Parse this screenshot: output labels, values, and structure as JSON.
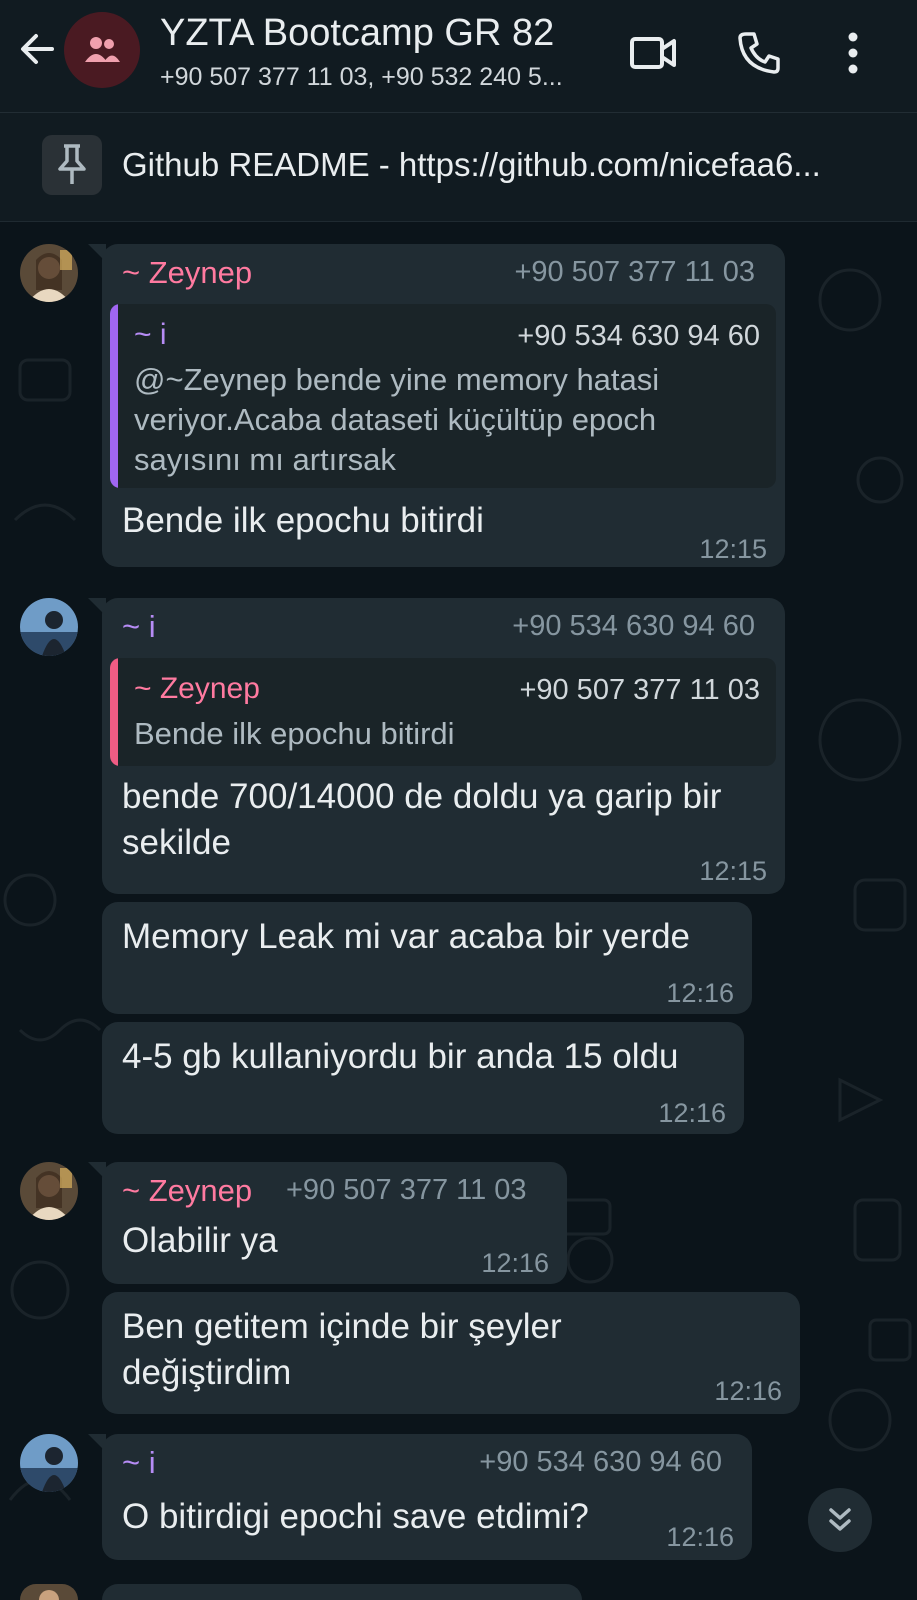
{
  "header": {
    "title": "YZTA Bootcamp GR 82",
    "subtitle": "+90 507 377 11 03, +90 532 240 5..."
  },
  "pinned": {
    "text": "Github README - https://github.com/nicefaa6..."
  },
  "colors": {
    "zeynep": "#ff7aa0",
    "i_user": "#b68cf5",
    "i_quote_bar": "#a066f2",
    "zeynep_quote_bar": "#ef5c84"
  },
  "messages": [
    {
      "sender": "~ Zeynep",
      "phone": "+90 507 377 11 03",
      "quote": {
        "sender": "~ i",
        "phone": "+90 534 630 94 60",
        "lines": [
          "@~Zeynep bende yine memory hatasi",
          "veriyor.Acaba dataseti küçültüp epoch",
          "sayısını mı artırsak"
        ]
      },
      "text": "Bende ilk epochu bitirdi",
      "time": "12:15"
    },
    {
      "sender": "~ i",
      "phone": "+90 534 630 94 60",
      "quote": {
        "sender": "~ Zeynep",
        "phone": "+90 507 377 11 03",
        "lines": [
          "Bende ilk epochu bitirdi"
        ]
      },
      "text_lines": [
        "bende 700/14000 de doldu ya garip bir",
        "sekilde"
      ],
      "time": "12:15"
    },
    {
      "text": "Memory Leak mi var acaba bir yerde",
      "time": "12:16"
    },
    {
      "text": "4-5 gb kullaniyordu bir anda 15 oldu",
      "time": "12:16"
    },
    {
      "sender": "~ Zeynep",
      "phone": "+90 507 377 11 03",
      "text": "Olabilir ya",
      "time": "12:16"
    },
    {
      "text_lines": [
        "Ben getitem içinde bir şeyler",
        "değiştirdim"
      ],
      "time": "12:16"
    },
    {
      "sender": "~ i",
      "phone": "+90 534 630 94 60",
      "text": "O bitirdigi epochi save etdimi?",
      "time": "12:16"
    }
  ]
}
